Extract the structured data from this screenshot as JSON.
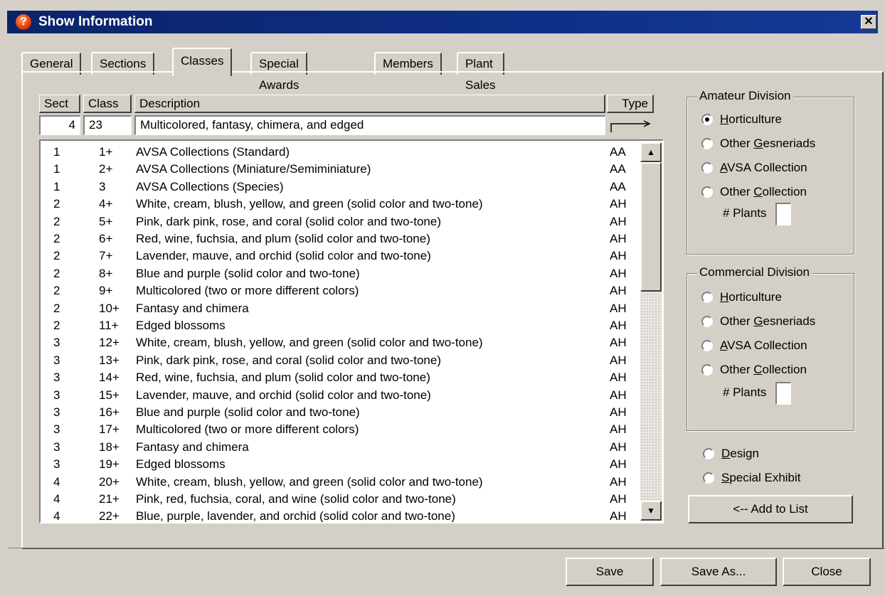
{
  "window": {
    "title": "Show Information",
    "close_glyph": "✕",
    "title_icon": "?"
  },
  "tabs": [
    {
      "label": "General"
    },
    {
      "label": "Sections"
    },
    {
      "label": "Classes",
      "active": true
    },
    {
      "label": "Special Awards"
    },
    {
      "label": "Members"
    },
    {
      "label": "Plant Sales"
    }
  ],
  "columns": {
    "sect": "Sect",
    "class": "Class",
    "description": "Description",
    "type": "Type"
  },
  "edit": {
    "sect": "4",
    "class": "23",
    "description": "Multicolored, fantasy, chimera, and edged"
  },
  "rows": [
    {
      "sect": "1",
      "class": "1+",
      "desc": "AVSA Collections (Standard)",
      "type": "AA"
    },
    {
      "sect": "1",
      "class": "2+",
      "desc": "AVSA Collections (Miniature/Semiminiature)",
      "type": "AA"
    },
    {
      "sect": "1",
      "class": "3",
      "desc": "AVSA Collections (Species)",
      "type": "AA"
    },
    {
      "sect": "2",
      "class": "4+",
      "desc": "White, cream, blush, yellow, and green (solid color and two-tone)",
      "type": "AH"
    },
    {
      "sect": "2",
      "class": "5+",
      "desc": "Pink, dark pink, rose, and coral (solid color and two-tone)",
      "type": "AH"
    },
    {
      "sect": "2",
      "class": "6+",
      "desc": "Red, wine, fuchsia, and plum (solid color and two-tone)",
      "type": "AH"
    },
    {
      "sect": "2",
      "class": "7+",
      "desc": "Lavender, mauve, and orchid (solid color and two-tone)",
      "type": "AH"
    },
    {
      "sect": "2",
      "class": "8+",
      "desc": "Blue and purple (solid color and two-tone)",
      "type": "AH"
    },
    {
      "sect": "2",
      "class": "9+",
      "desc": "Multicolored (two or more different colors)",
      "type": "AH"
    },
    {
      "sect": "2",
      "class": "10+",
      "desc": "Fantasy and chimera",
      "type": "AH"
    },
    {
      "sect": "2",
      "class": "11+",
      "desc": "Edged blossoms",
      "type": "AH"
    },
    {
      "sect": "3",
      "class": "12+",
      "desc": "White, cream, blush, yellow, and green (solid color and two-tone)",
      "type": "AH"
    },
    {
      "sect": "3",
      "class": "13+",
      "desc": "Pink, dark pink, rose, and coral (solid color and two-tone)",
      "type": "AH"
    },
    {
      "sect": "3",
      "class": "14+",
      "desc": "Red, wine, fuchsia, and plum (solid color and two-tone)",
      "type": "AH"
    },
    {
      "sect": "3",
      "class": "15+",
      "desc": "Lavender, mauve, and orchid (solid color and two-tone)",
      "type": "AH"
    },
    {
      "sect": "3",
      "class": "16+",
      "desc": "Blue and purple (solid color and two-tone)",
      "type": "AH"
    },
    {
      "sect": "3",
      "class": "17+",
      "desc": "Multicolored (two or more different colors)",
      "type": "AH"
    },
    {
      "sect": "3",
      "class": "18+",
      "desc": "Fantasy and chimera",
      "type": "AH"
    },
    {
      "sect": "3",
      "class": "19+",
      "desc": "Edged blossoms",
      "type": "AH"
    },
    {
      "sect": "4",
      "class": "20+",
      "desc": "White, cream, blush, yellow, and green (solid color and two-tone)",
      "type": "AH"
    },
    {
      "sect": "4",
      "class": "21+",
      "desc": "Pink, red, fuchsia, coral, and wine (solid color and two-tone)",
      "type": "AH"
    },
    {
      "sect": "4",
      "class": "22+",
      "desc": "Blue, purple, lavender, and orchid (solid color and two-tone)",
      "type": "AH"
    }
  ],
  "amateur": {
    "title": "Amateur Division",
    "options": [
      {
        "u": "H",
        "rest": "orticulture",
        "pre": ""
      },
      {
        "pre": "Other ",
        "u": "G",
        "rest": "esneriads"
      },
      {
        "pre": "",
        "u": "A",
        "rest": "VSA Collection"
      },
      {
        "pre": "Other ",
        "u": "C",
        "rest": "ollection"
      }
    ],
    "plants_label": "# Plants",
    "selected": 0
  },
  "commercial": {
    "title": "Commercial Division",
    "options": [
      {
        "u": "H",
        "rest": "orticulture",
        "pre": ""
      },
      {
        "pre": "Other ",
        "u": "G",
        "rest": "esneriads"
      },
      {
        "pre": "",
        "u": "A",
        "rest": "VSA Collection"
      },
      {
        "pre": "Other ",
        "u": "C",
        "rest": "ollection"
      }
    ],
    "plants_label": "# Plants"
  },
  "extra": {
    "design": {
      "u": "D",
      "rest": "esign"
    },
    "special": {
      "u": "S",
      "rest": "pecial Exhibit"
    }
  },
  "buttons": {
    "add": "<-- Add to List",
    "save": "Save",
    "save_as": "Save As...",
    "close": "Close"
  },
  "scrollbar": {
    "up": "▲",
    "down": "▼"
  }
}
